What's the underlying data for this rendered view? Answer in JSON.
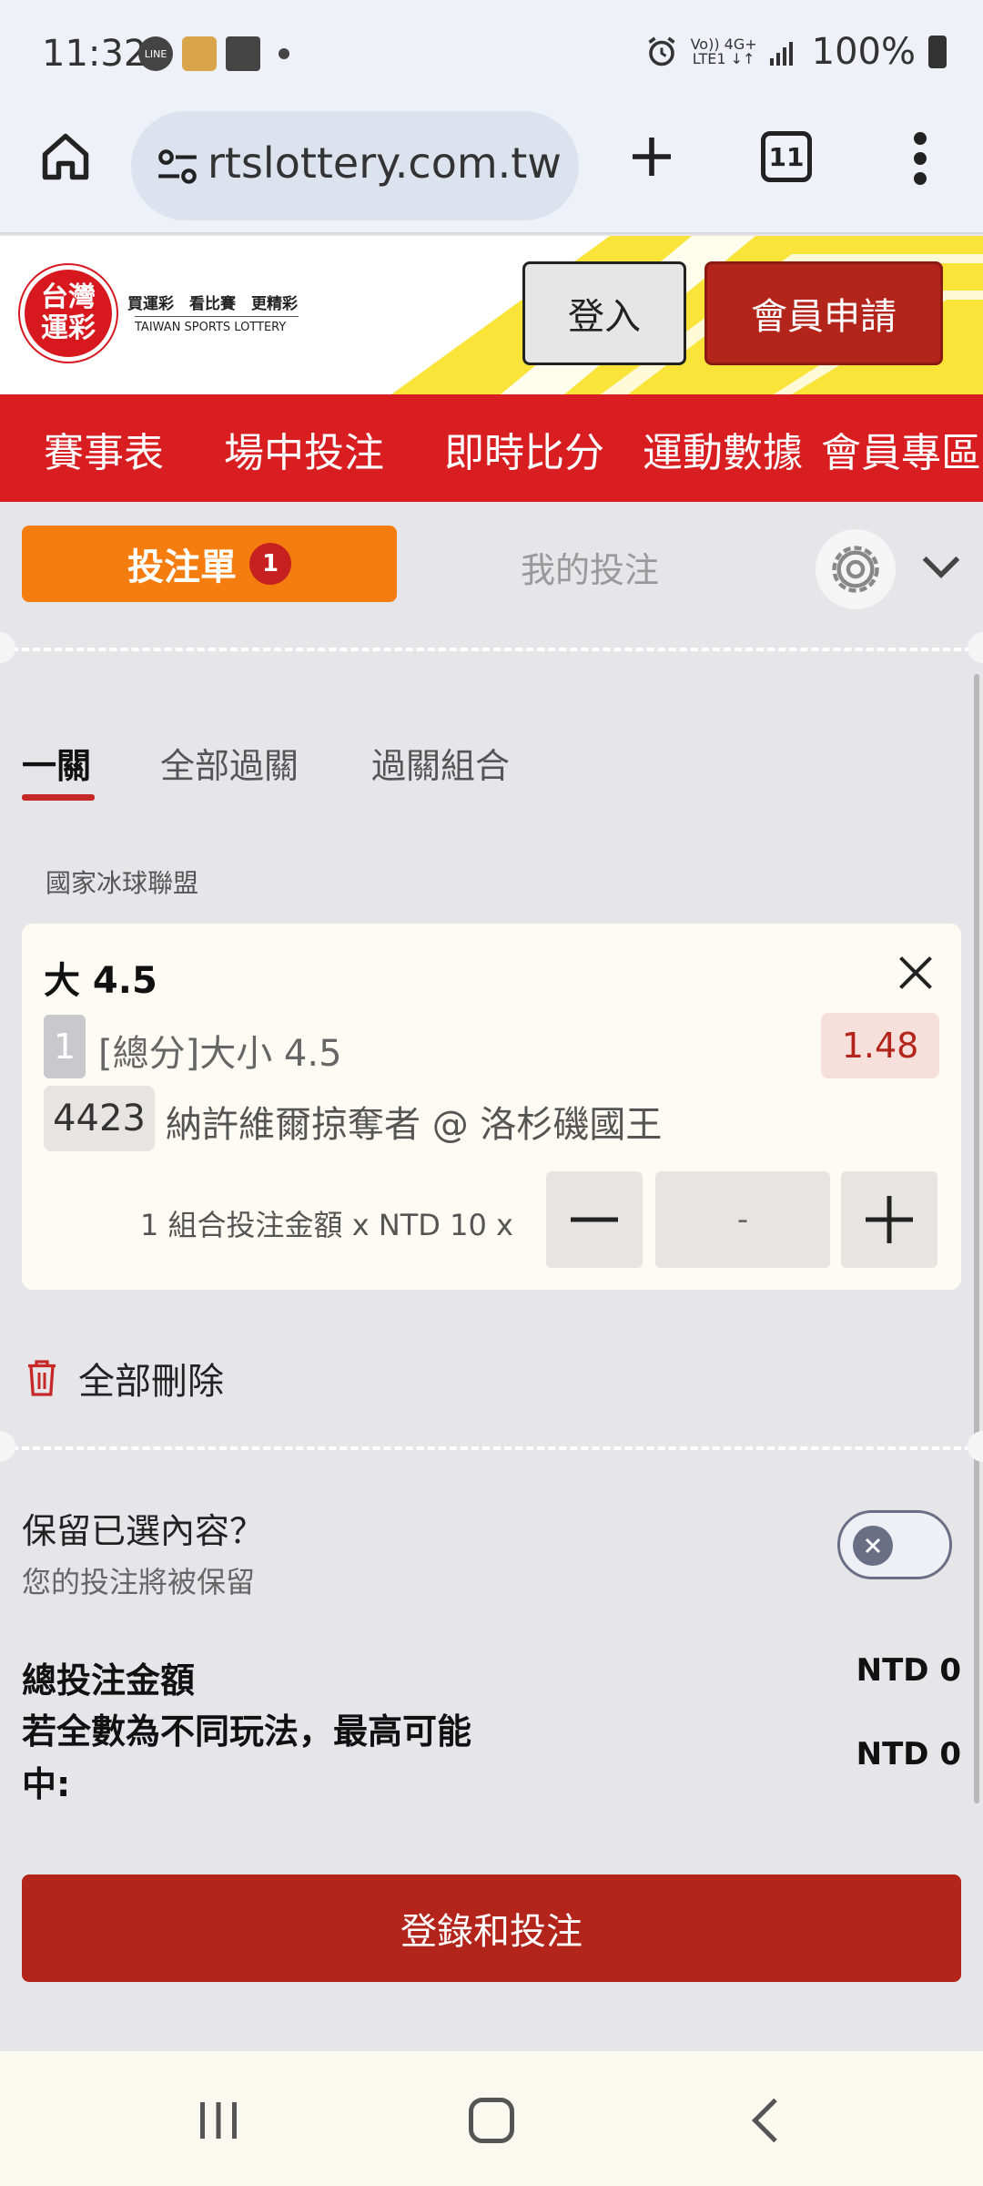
{
  "status_bar": {
    "time": "11:32",
    "battery": "100%",
    "network_top": "Vo)) 4G+",
    "network_bottom": "LTE1 ↓↑",
    "notif_line": "LINE"
  },
  "browser": {
    "url": "rtslottery.com.tw",
    "tab_count": "11"
  },
  "site_header": {
    "logo_mark_top": "台灣",
    "logo_mark_bottom": "運彩",
    "logo_tagline": "買運彩　看比賽　更精彩",
    "logo_sub": "TAIWAN SPORTS LOTTERY",
    "login_label": "登入",
    "signup_label": "會員申請"
  },
  "nav": {
    "items": [
      "賽事表",
      "場中投注",
      "即時比分",
      "運動數據",
      "會員專區"
    ]
  },
  "betslip": {
    "tab_label": "投注單",
    "tab_badge": "1",
    "my_bets_label": "我的投注",
    "subtabs": [
      "一關",
      "全部過關",
      "過關組合"
    ],
    "league": "國家冰球聯盟",
    "bet": {
      "pick": "大 4.5",
      "index": "1",
      "market": "[總分]大小 4.5",
      "odds": "1.48",
      "code": "4423",
      "match": "納許維爾掠奪者 @ 洛杉磯國王",
      "stake_label": "1 組合投注金額 x NTD 10 x",
      "amount": "-"
    },
    "delete_all": "全部刪除",
    "retain_title": "保留已選內容？",
    "retain_sub": "您的投注將被保留",
    "total_label": "總投注金額",
    "total_value": "NTD 0",
    "maxwin_label": "若全數為不同玩法，最高可能中:",
    "maxwin_value": "NTD 0",
    "submit_label": "登錄和投注"
  },
  "colors": {
    "brand_red": "#d91e22",
    "button_red": "#b3241b",
    "slip_orange": "#f57c0e"
  }
}
